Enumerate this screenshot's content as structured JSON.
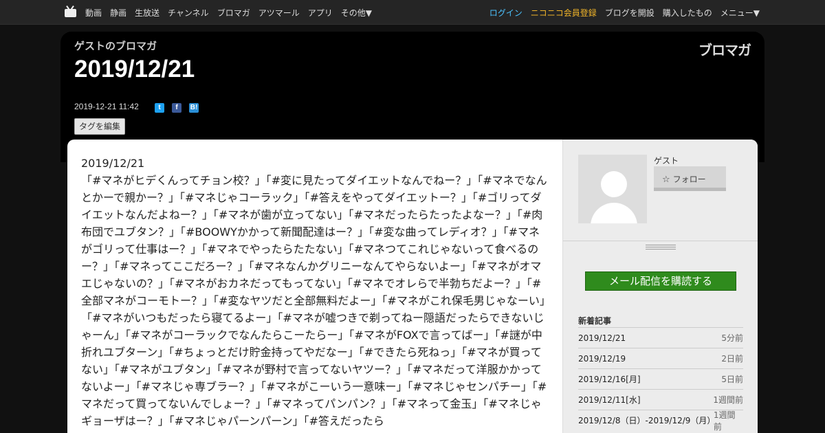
{
  "nav": {
    "items": [
      "動画",
      "静画",
      "生放送",
      "チャンネル",
      "ブロマガ",
      "アツマール",
      "アプリ",
      "その他▼"
    ],
    "login": "ログイン",
    "register": "ニコニコ会員登録",
    "open_blog": "ブログを開設",
    "purchased": "購入したもの",
    "menu": "メニュー▼"
  },
  "header": {
    "blog_name": "ゲストのブロマガ",
    "title": "2019/12/21",
    "logo": "ブロマガ",
    "date": "2019-12-21 11:42",
    "share": {
      "twitter": "t",
      "facebook": "f",
      "hatena": "B!"
    },
    "tag_edit": "タグを編集"
  },
  "article": {
    "heading": "2019/12/21",
    "body": "「#マネがヒデくんってチョン校？」「#変に見たってダイエットなんでねー？」「#マネでなんとかーで親かー？」「#マネじゃコーラック」「#答えをやってダイエットー？」「#ゴリってダイエットなんだよねー？」「#マネが歯が立ってない」「#マネだったらたったよなー？」「#肉布団でユブタン？」「#BOOWYかかって新聞配達はー？」「#変な曲ってレディオ？」「#マネがゴリって仕事はー？」「#マネでやったらたたない」「#マネつてこれじゃないって食べるのー？」「#マネってここだろー？」「#マネなんかグリニーなんてやらないよー」「#マネがオマエじゃないの？」「#マネがおカネだってもってない」「#マネでオレらで半勃ちだよー？」「#全部マネがコーモトー？」「#変なヤツだと全部無料だよー」「#マネがこれ保毛男じゃなーい」「#マネがいつもだったら寝てるよー」「#マネが嘘つきで剃ってねー隠語だったらできないじゃーん」「#マネがコーラックでなんたらこーたらー」「#マネがFOXで言ってばー」「#謎が中折れユブターン」「#ちょっとだけ貯金持ってやだなー」「#できたら死ねっ」「#マネが買ってない」「#マネがユブタン」「#マネが野村で言ってないヤツー？」「#マネだって洋服かかってないよー」「#マネじゃ専ブラー？」「#マネがこーいう一意味ー」「#マネじゃセンパチー」「#マネだって買ってないんでしょー？」「#マネってパンパン？」「#マネって金玉」「#マネじゃギョーザはー？」「#マネじゃパーンパーン」「#答えだったら"
  },
  "sidebar": {
    "user_name": "ゲスト",
    "follow": "フォロー",
    "subscribe": "メール配信を購読する",
    "recent_heading": "新着記事",
    "recent": [
      {
        "title": "2019/12/21",
        "age": "5分前"
      },
      {
        "title": "2019/12/19",
        "age": "2日前"
      },
      {
        "title": "2019/12/16[月]",
        "age": "5日前"
      },
      {
        "title": "2019/12/11[水]",
        "age": "1週間前"
      },
      {
        "title": "2019/12/8（日）-2019/12/9（月）",
        "age": "1週間前"
      }
    ]
  }
}
